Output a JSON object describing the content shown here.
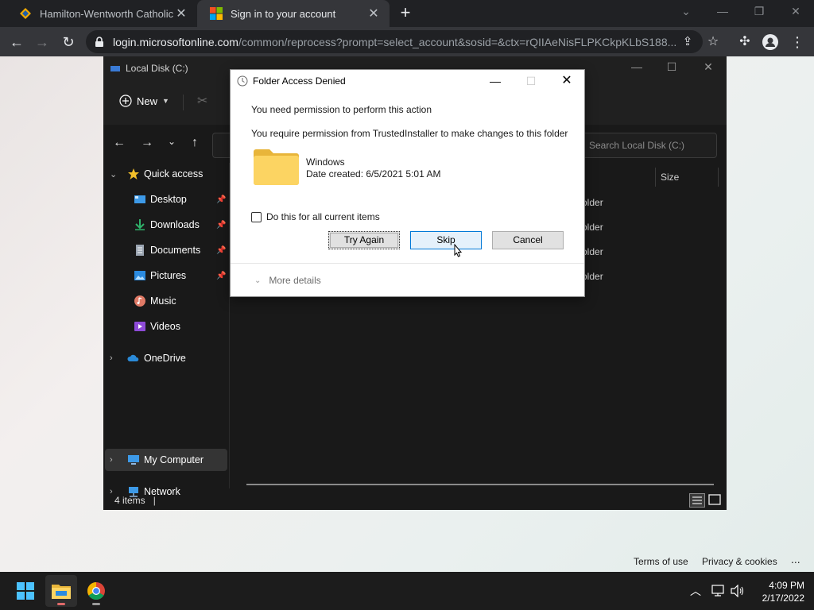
{
  "browser": {
    "tabs": [
      {
        "title": "Hamilton-Wentworth Catholic Di",
        "active": false
      },
      {
        "title": "Sign in to your account",
        "active": true
      }
    ],
    "new_tab": "+",
    "url_host": "login.microsoftonline.com",
    "url_path": "/common/reprocess?prompt=select_account&sosid=&ctx=rQIIAeNisFLPKCkpKLbS188..."
  },
  "page": {
    "footer": {
      "terms": "Terms of use",
      "privacy": "Privacy & cookies",
      "more": "..."
    }
  },
  "explorer": {
    "title": "Local Disk (C:)",
    "new_label": "New",
    "search_placeholder": "Search Local Disk (C:)",
    "column_size": "Size",
    "row_types": [
      "older",
      "older",
      "older",
      "older"
    ],
    "nav": [
      {
        "label": "Quick access"
      },
      {
        "label": "Desktop"
      },
      {
        "label": "Downloads"
      },
      {
        "label": "Documents"
      },
      {
        "label": "Pictures"
      },
      {
        "label": "Music"
      },
      {
        "label": "Videos"
      },
      {
        "label": "OneDrive"
      },
      {
        "label": "My Computer"
      },
      {
        "label": "Network"
      }
    ],
    "status": "4 items"
  },
  "dialog": {
    "title": "Folder Access Denied",
    "line1": "You need permission to perform this action",
    "line2": "You require permission from TrustedInstaller to make changes to this folder",
    "file_name": "Windows",
    "file_date": "Date created: 6/5/2021 5:01 AM",
    "checkbox_label": "Do this for all current items",
    "buttons": {
      "try_again": "Try Again",
      "skip": "Skip",
      "cancel": "Cancel"
    },
    "more_details": "More details"
  },
  "taskbar": {
    "time": "4:09 PM",
    "date": "2/17/2022"
  },
  "colors": {
    "accent": "#0078d7",
    "explorer_bg": "#191919",
    "chrome_bg": "#202124"
  }
}
